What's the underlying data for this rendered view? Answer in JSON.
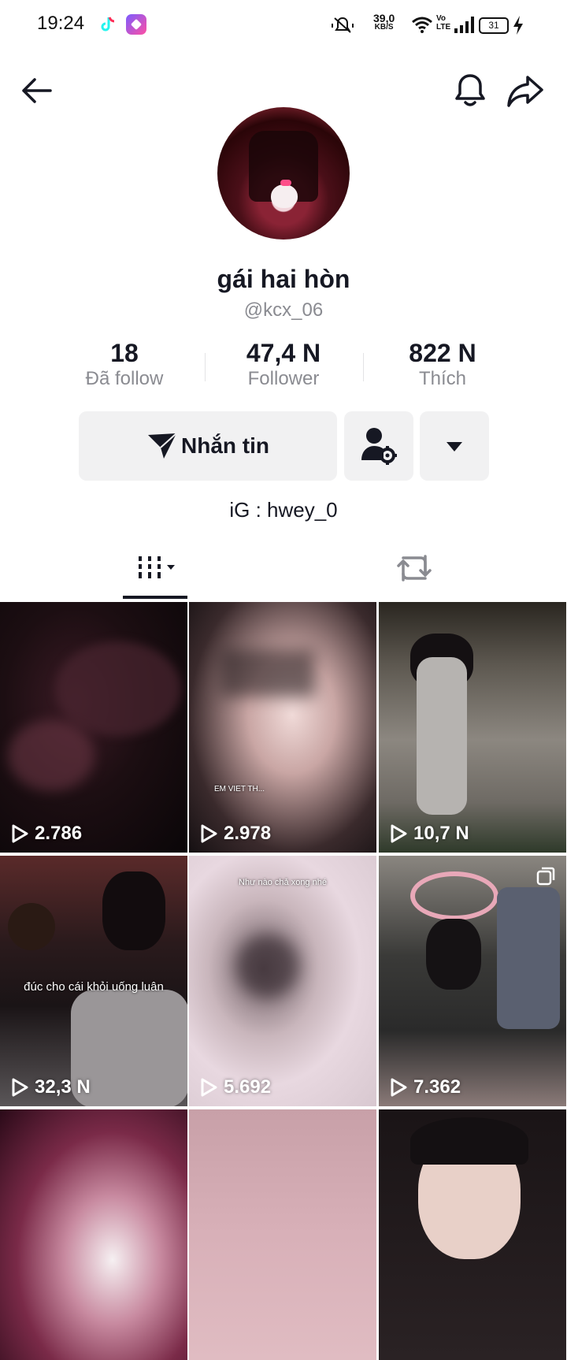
{
  "status_bar": {
    "time": "19:24",
    "net_speed_value": "39,0",
    "net_speed_unit": "KB/S",
    "network_label": "Vo LTE",
    "battery": "31"
  },
  "profile": {
    "display_name": "gái hai hòn",
    "username": "@kcx_06",
    "bio": "iG : hwey_0"
  },
  "stats": [
    {
      "value": "18",
      "label": "Đã follow"
    },
    {
      "value": "47,4 N",
      "label": "Follower"
    },
    {
      "value": "822 N",
      "label": "Thích"
    }
  ],
  "actions": {
    "message_label": "Nhắn tin"
  },
  "videos": [
    {
      "views": "2.786"
    },
    {
      "views": "2.978",
      "caption": "EM VIET TH..."
    },
    {
      "views": "10,7 N"
    },
    {
      "views": "32,3 N",
      "caption": "đúc cho cái khỏi uống luân"
    },
    {
      "views": "5.692",
      "caption": "Như nào chả xong nhé"
    },
    {
      "views": "7.362"
    },
    {
      "views": ""
    },
    {
      "views": ""
    },
    {
      "views": ""
    }
  ],
  "colors": {
    "text_primary": "#161823",
    "text_secondary": "#8a8b91",
    "button_bg": "#f1f1f2"
  }
}
